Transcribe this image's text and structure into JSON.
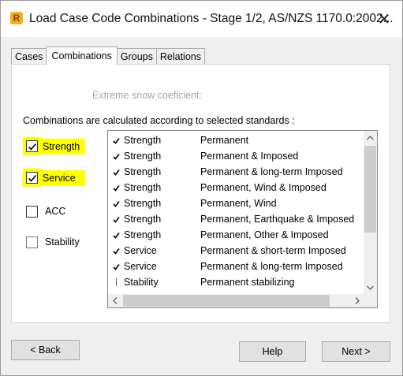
{
  "window": {
    "title": "Load Case Code Combinations - Stage 1/2, AS/NZS 1170.0:2002...",
    "close_glyph": "✕"
  },
  "tabs": [
    {
      "label": "Cases",
      "active": false
    },
    {
      "label": "Combinations",
      "active": true
    },
    {
      "label": "Groups",
      "active": false
    },
    {
      "label": "Relations",
      "active": false
    }
  ],
  "form": {
    "snow_label": "Extreme snow coeficient:",
    "info_label": "Combinations are calculated according to selected standards :",
    "standards": [
      {
        "label": "Strength",
        "checked": true,
        "highlighted": true
      },
      {
        "label": "Service",
        "checked": true,
        "highlighted": true
      },
      {
        "label": "ACC",
        "checked": false,
        "highlighted": false
      },
      {
        "label": "Stability",
        "checked": false,
        "highlighted": false
      }
    ]
  },
  "combinations": [
    {
      "checked": true,
      "name": "Strength",
      "description": "Permanent"
    },
    {
      "checked": true,
      "name": "Strength",
      "description": "Permanent & Imposed"
    },
    {
      "checked": true,
      "name": "Strength",
      "description": "Permanent & long-term Imposed"
    },
    {
      "checked": true,
      "name": "Strength",
      "description": "Permanent, Wind & Imposed"
    },
    {
      "checked": true,
      "name": "Strength",
      "description": "Permanent, Wind"
    },
    {
      "checked": true,
      "name": "Strength",
      "description": "Permanent, Earthquake & Imposed"
    },
    {
      "checked": true,
      "name": "Strength",
      "description": "Permanent, Other & Imposed"
    },
    {
      "checked": true,
      "name": "Service",
      "description": "Permanent & short-term Imposed"
    },
    {
      "checked": true,
      "name": "Service",
      "description": "Permanent & long-term Imposed"
    },
    {
      "checked": false,
      "name": "Stability",
      "description": "Permanent stabilizing"
    }
  ],
  "buttons": {
    "back": "< Back",
    "help": "Help",
    "next": "Next >"
  },
  "colors": {
    "highlight": "#ffff00",
    "app_icon": "#f2b21a"
  }
}
